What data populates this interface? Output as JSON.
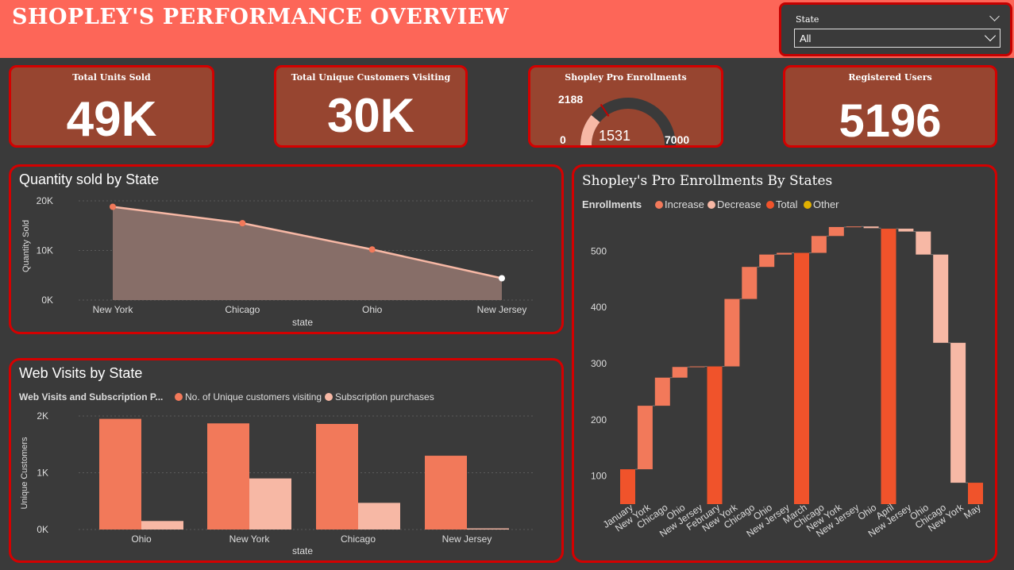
{
  "header": {
    "title": "SHOPLEY'S PERFORMANCE OVERVIEW"
  },
  "slicer": {
    "label": "State",
    "value": "All"
  },
  "kpis": {
    "units": {
      "title": "Total Units Sold",
      "value": "49K"
    },
    "customers": {
      "title": "Total Unique Customers Visiting",
      "value": "30K"
    },
    "enrollments": {
      "title": "Shopley Pro Enrollments",
      "value": "1531",
      "min": "0",
      "max": "7000",
      "target": "2188"
    },
    "registered": {
      "title": "Registered Users",
      "value": "5196"
    }
  },
  "colors": {
    "accent": "#fd6658",
    "border": "#d40000",
    "kpi_bg": "#974530",
    "series1": "#f2795a",
    "series2": "#f7b8a5",
    "total": "#f0532b",
    "other": "#e0b000"
  },
  "chart_data": [
    {
      "type": "area",
      "title": "Quantity sold by State",
      "xlabel": "state",
      "ylabel": "Quantity Sold",
      "categories": [
        "New York",
        "Chicago",
        "Ohio",
        "New Jersey"
      ],
      "values": [
        18800,
        15500,
        10200,
        4400
      ],
      "ylim": [
        0,
        20000
      ],
      "yticks": [
        "0K",
        "10K",
        "20K"
      ]
    },
    {
      "type": "bar",
      "title": "Web Visits by State",
      "xlabel": "state",
      "ylabel": "Unique Customers",
      "legend_title": "Web Visits and Subscription P...",
      "categories": [
        "Ohio",
        "New York",
        "Chicago",
        "New Jersey"
      ],
      "series": [
        {
          "name": "No. of Unique customers visiting",
          "values": [
            1950,
            1870,
            1860,
            1300
          ]
        },
        {
          "name": "Subscription purchases",
          "values": [
            150,
            900,
            470,
            20
          ]
        }
      ],
      "ylim": [
        0,
        2000
      ],
      "yticks": [
        "0K",
        "1K",
        "2K"
      ]
    },
    {
      "type": "bar",
      "title": "Shopley's Pro Enrollments By States",
      "legend_title": "Enrollments",
      "legend": [
        "Increase",
        "Decrease",
        "Total",
        "Other"
      ],
      "ylim": [
        50,
        550
      ],
      "yticks": [
        "100",
        "200",
        "300",
        "400",
        "500"
      ],
      "steps": [
        {
          "label": "January",
          "kind": "total",
          "start": 50,
          "end": 112
        },
        {
          "label": "New York",
          "kind": "increase",
          "start": 112,
          "end": 225
        },
        {
          "label": "Chicago",
          "kind": "increase",
          "start": 225,
          "end": 275
        },
        {
          "label": "Ohio",
          "kind": "increase",
          "start": 275,
          "end": 294
        },
        {
          "label": "New Jersey",
          "kind": "increase",
          "start": 294,
          "end": 295
        },
        {
          "label": "February",
          "kind": "total",
          "start": 50,
          "end": 295
        },
        {
          "label": "New York",
          "kind": "increase",
          "start": 295,
          "end": 415
        },
        {
          "label": "Chicago",
          "kind": "increase",
          "start": 415,
          "end": 472
        },
        {
          "label": "Ohio",
          "kind": "increase",
          "start": 472,
          "end": 494
        },
        {
          "label": "New Jersey",
          "kind": "increase",
          "start": 494,
          "end": 497
        },
        {
          "label": "March",
          "kind": "total",
          "start": 50,
          "end": 497
        },
        {
          "label": "Chicago",
          "kind": "increase",
          "start": 497,
          "end": 527
        },
        {
          "label": "New York",
          "kind": "increase",
          "start": 527,
          "end": 543
        },
        {
          "label": "New Jersey",
          "kind": "increase",
          "start": 543,
          "end": 544
        },
        {
          "label": "Ohio",
          "kind": "decrease",
          "start": 544,
          "end": 541
        },
        {
          "label": "April",
          "kind": "total",
          "start": 50,
          "end": 540
        },
        {
          "label": "New Jersey",
          "kind": "decrease",
          "start": 540,
          "end": 535
        },
        {
          "label": "Ohio",
          "kind": "decrease",
          "start": 535,
          "end": 494
        },
        {
          "label": "Chicago",
          "kind": "decrease",
          "start": 494,
          "end": 337
        },
        {
          "label": "New York",
          "kind": "decrease",
          "start": 337,
          "end": 88
        },
        {
          "label": "May",
          "kind": "total",
          "start": 50,
          "end": 88
        }
      ]
    }
  ]
}
